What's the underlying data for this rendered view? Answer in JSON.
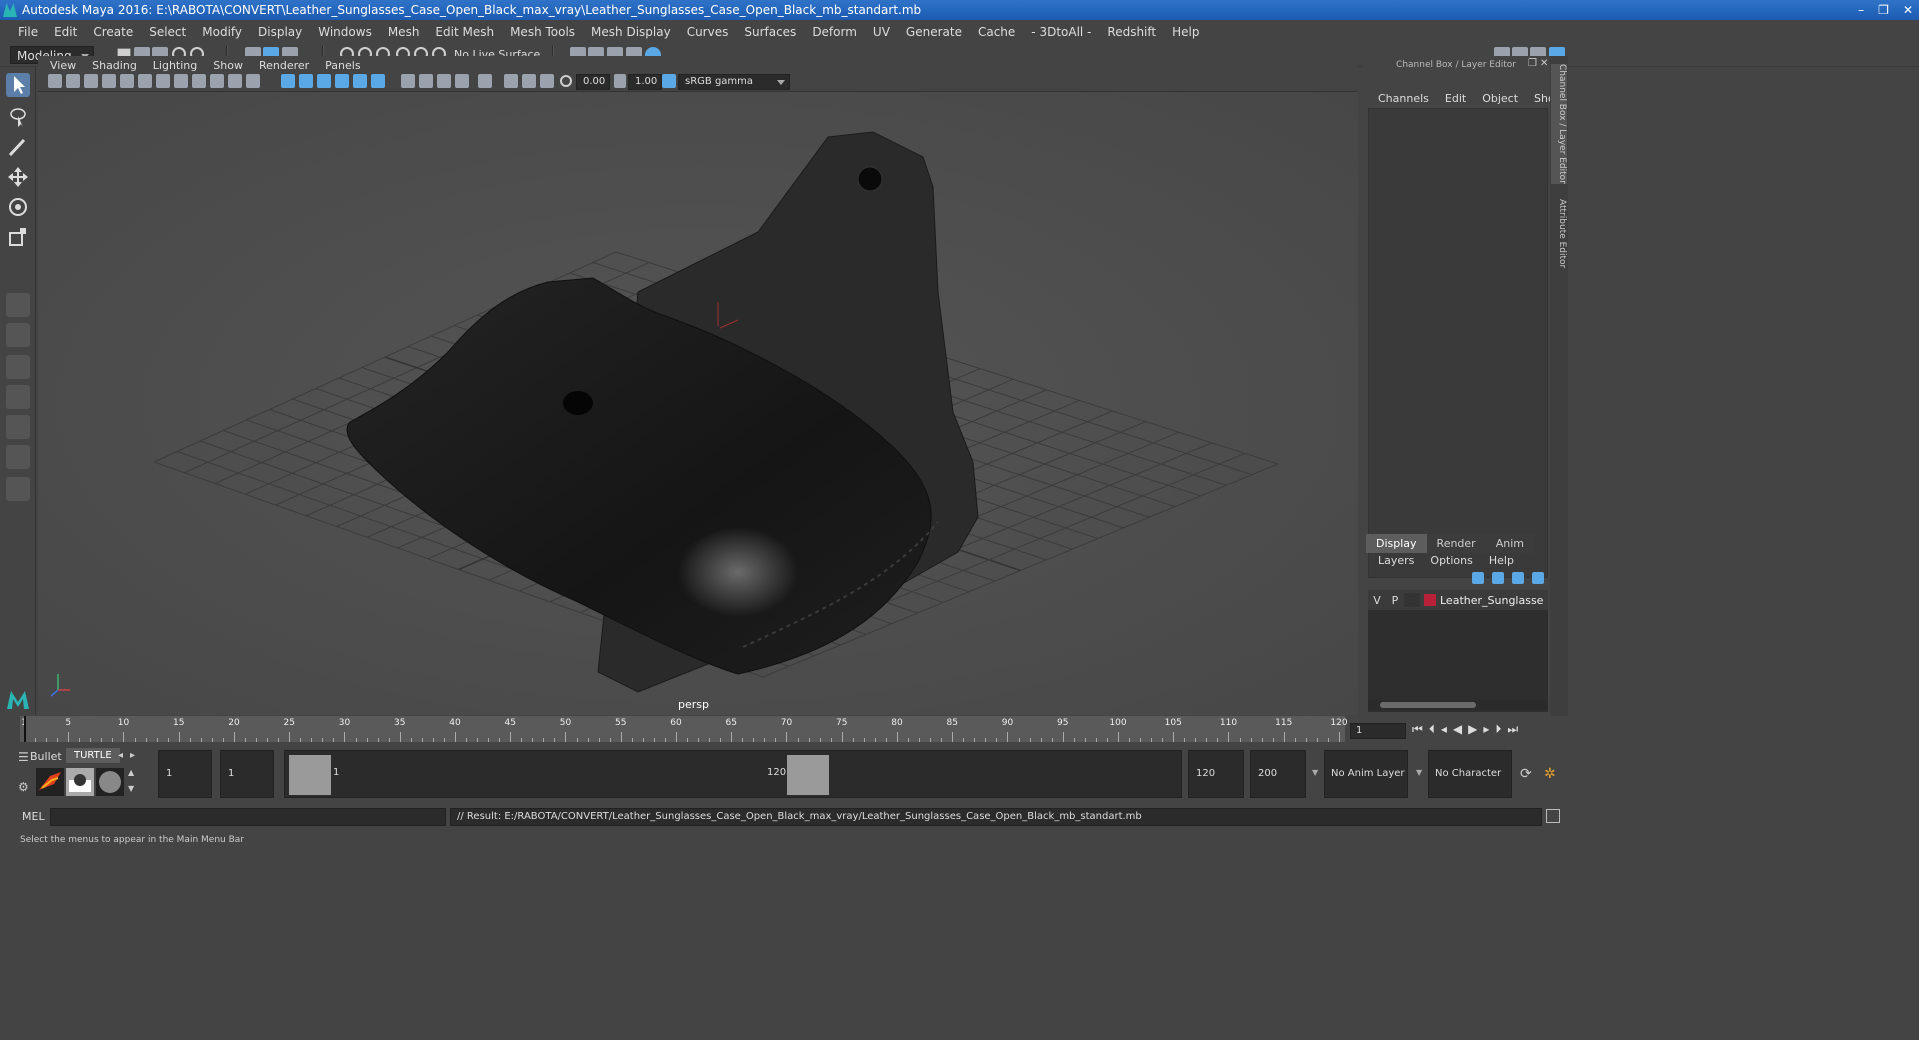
{
  "window": {
    "title": "Autodesk Maya 2016: E:\\RABOTA\\CONVERT\\Leather_Sunglasses_Case_Open_Black_max_vray\\Leather_Sunglasses_Case_Open_Black_mb_standart.mb",
    "minimize": "–",
    "restore": "❐",
    "close": "✕"
  },
  "menu": [
    "File",
    "Edit",
    "Create",
    "Select",
    "Modify",
    "Display",
    "Windows",
    "Mesh",
    "Edit Mesh",
    "Mesh Tools",
    "Mesh Display",
    "Curves",
    "Surfaces",
    "Deform",
    "UV",
    "Generate",
    "Cache",
    "- 3DtoAll -",
    "Redshift",
    "Help"
  ],
  "shelf": {
    "mode": "Modeling",
    "live_surface": "No Live Surface"
  },
  "viewport": {
    "menu": [
      "View",
      "Shading",
      "Lighting",
      "Show",
      "Renderer",
      "Panels"
    ],
    "exposure": "0.00",
    "gamma": "1.00",
    "color_space": "sRGB gamma",
    "camera_label": "persp"
  },
  "channel_box": {
    "header": "Channel Box / Layer Editor",
    "menu": [
      "Channels",
      "Edit",
      "Object",
      "Show"
    ]
  },
  "layer_editor": {
    "tabs": [
      "Display",
      "Render",
      "Anim"
    ],
    "active_tab": "Display",
    "menu": [
      "Layers",
      "Options",
      "Help"
    ],
    "layer": {
      "v": "V",
      "p": "P",
      "name": "Leather_Sunglasses_Case_Open_Black",
      "color": "#b8213a"
    }
  },
  "side_tabs": [
    "Channel Box / Layer Editor",
    "Attribute Editor"
  ],
  "timeline": {
    "ticks": [
      "1",
      "5",
      "10",
      "15",
      "20",
      "25",
      "30",
      "35",
      "40",
      "45",
      "50",
      "55",
      "60",
      "65",
      "70",
      "75",
      "80",
      "85",
      "90",
      "95",
      "100",
      "105",
      "110",
      "115",
      "120"
    ],
    "current_frame": "1"
  },
  "range": {
    "shelf_tabs": [
      "Bullet",
      "TURTLE"
    ],
    "start_outer": "1",
    "start_inner": "1",
    "slider_start": "1",
    "slider_end": "120",
    "end_inner": "120",
    "end_outer": "200",
    "anim_layer": "No Anim Layer",
    "character_set": "No Character Set"
  },
  "command": {
    "mode": "MEL",
    "result": "// Result: E:/RABOTA/CONVERT/Leather_Sunglasses_Case_Open_Black_max_vray/Leather_Sunglasses_Case_Open_Black_mb_standart.mb"
  },
  "status": "Select the menus to appear in the Main Menu Bar"
}
